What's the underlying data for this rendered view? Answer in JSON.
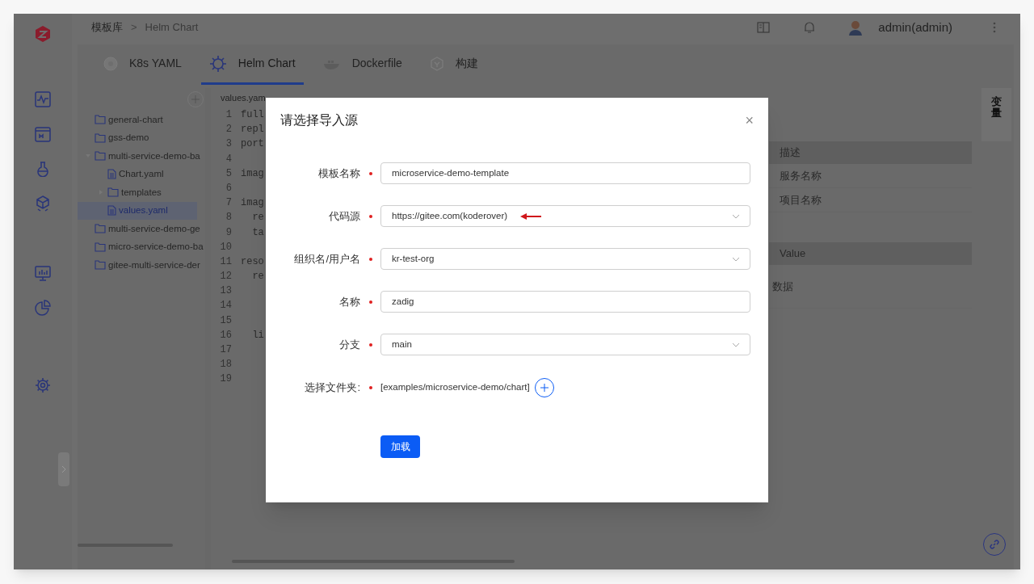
{
  "breadcrumb": [
    "模板库",
    "Helm Chart"
  ],
  "breadcrumb_separator": ">",
  "header": {
    "user": "admin(admin)"
  },
  "tabs": [
    {
      "label": "K8s YAML",
      "kind": "k8s",
      "selected": false
    },
    {
      "label": "Helm Chart",
      "kind": "helm",
      "selected": true
    },
    {
      "label": "Dockerfile",
      "kind": "docker",
      "selected": false
    },
    {
      "label": "构建",
      "kind": "build",
      "selected": false
    }
  ],
  "file_tree": [
    {
      "name": "general-chart",
      "kind": "folder"
    },
    {
      "name": "gss-demo",
      "kind": "folder"
    },
    {
      "name": "multi-service-demo-ba",
      "kind": "folder",
      "expanded": true,
      "children": [
        {
          "name": "Chart.yaml",
          "kind": "file",
          "selected": false
        },
        {
          "name": "templates",
          "kind": "folder",
          "expanded": false
        },
        {
          "name": "values.yaml",
          "kind": "file",
          "selected": true
        }
      ]
    },
    {
      "name": "multi-service-demo-ge",
      "kind": "folder"
    },
    {
      "name": "micro-service-demo-ba",
      "kind": "folder"
    },
    {
      "name": "gitee-multi-service-der",
      "kind": "folder"
    }
  ],
  "editor": {
    "file_name": "values.yam",
    "lines": [
      {
        "number": "1",
        "text": "full"
      },
      {
        "number": "2",
        "text": "repl"
      },
      {
        "number": "3",
        "text": "port"
      },
      {
        "number": "4"
      },
      {
        "number": "5",
        "text": "imag"
      },
      {
        "number": "6"
      },
      {
        "number": "7",
        "text": "imag"
      },
      {
        "number": "8",
        "text": "  re"
      },
      {
        "number": "9",
        "text": "  ta"
      },
      {
        "number": "10"
      },
      {
        "number": "11",
        "text": "reso"
      },
      {
        "number": "12",
        "text": "  re"
      },
      {
        "number": "13"
      },
      {
        "number": "14"
      },
      {
        "number": "15"
      },
      {
        "number": "16",
        "text": "  li"
      },
      {
        "number": "17"
      },
      {
        "number": "18"
      },
      {
        "number": "19"
      }
    ]
  },
  "right_panel": {
    "table_1": {
      "header": "描述",
      "rows": [
        "服务名称",
        "项目名称"
      ]
    },
    "table_2": {
      "header": "Value",
      "empty": "数据"
    },
    "side_tab": "变量"
  },
  "dialog": {
    "title": "请选择导入源",
    "close": "×",
    "fields": [
      {
        "label": "模板名称",
        "kind": "input",
        "value": "microservice-demo-template",
        "required": true,
        "annotated": false
      },
      {
        "label": "代码源",
        "kind": "select",
        "value": "https://gitee.com(koderover)",
        "required": true,
        "annotated": true
      },
      {
        "label": "组织名/用户名",
        "kind": "select",
        "value": "kr-test-org",
        "required": true,
        "annotated": false
      },
      {
        "label": "名称",
        "kind": "input",
        "value": "zadig",
        "required": true,
        "annotated": false
      },
      {
        "label": "分支",
        "kind": "select",
        "value": "main",
        "required": true,
        "annotated": false
      },
      {
        "label": "选择文件夹:",
        "kind": "folder",
        "value": "[examples/microservice-demo/chart]",
        "required": true,
        "annotated": false
      }
    ],
    "submit": "加载"
  }
}
